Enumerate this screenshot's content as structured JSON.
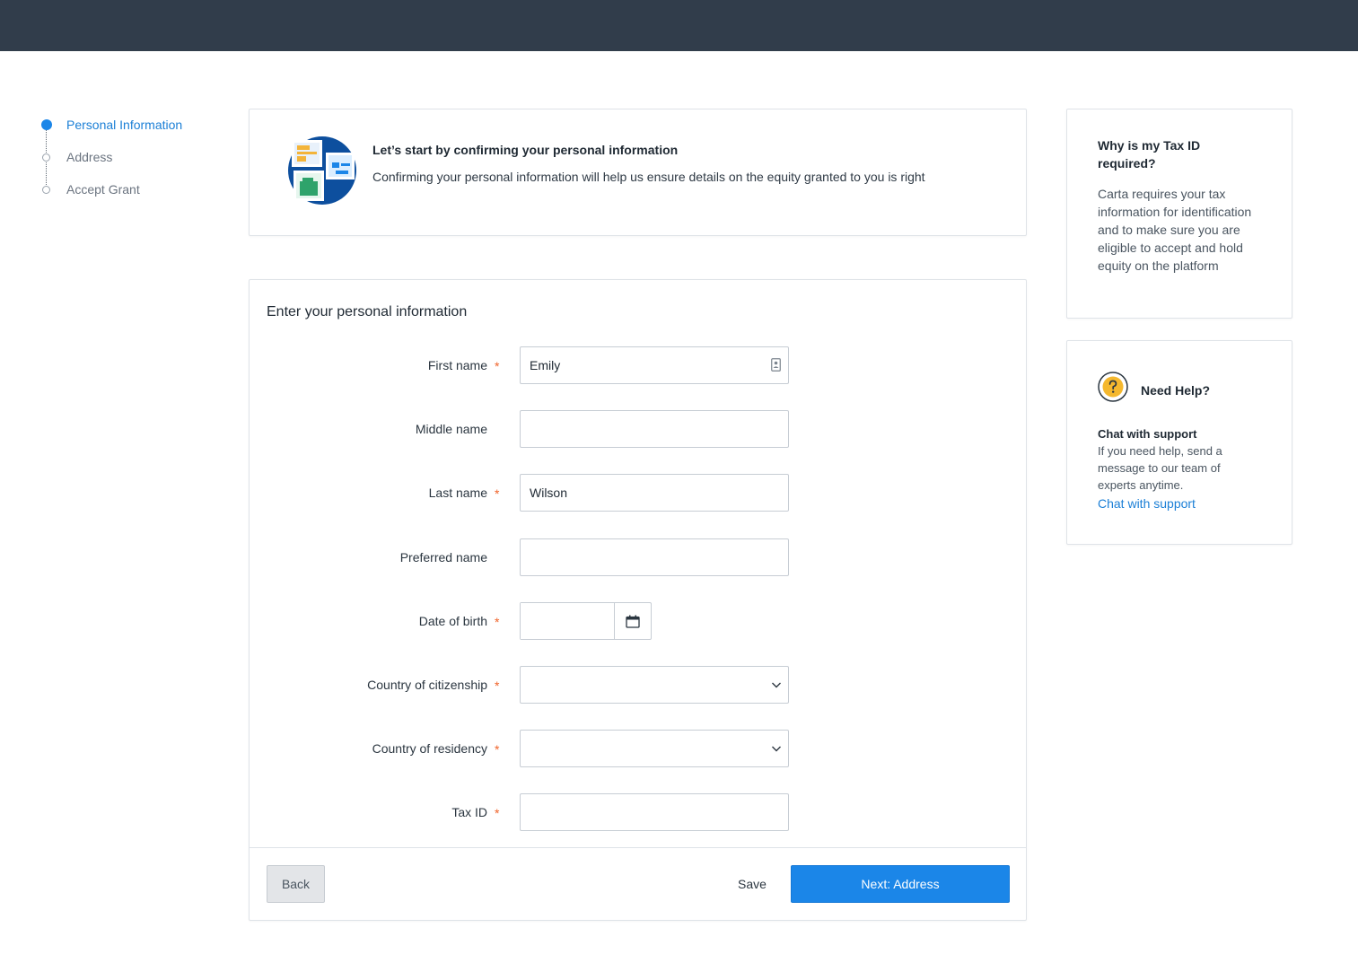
{
  "stepper": {
    "steps": [
      {
        "label": "Personal Information",
        "active": true
      },
      {
        "label": "Address",
        "active": false
      },
      {
        "label": "Accept Grant",
        "active": false
      }
    ]
  },
  "intro": {
    "title": "Let’s start by confirming your personal information",
    "text": "Confirming your personal information will help us ensure details on the equity granted to you is right"
  },
  "form": {
    "title": "Enter your personal information",
    "required_marker": "*",
    "fields": {
      "first_name": {
        "label": "First name",
        "value": "Emily",
        "required": true
      },
      "middle_name": {
        "label": "Middle name",
        "value": "",
        "required": false
      },
      "last_name": {
        "label": "Last name",
        "value": "Wilson",
        "required": true
      },
      "preferred_name": {
        "label": "Preferred name",
        "value": "",
        "required": false
      },
      "date_of_birth": {
        "label": "Date of birth",
        "value": "",
        "required": true
      },
      "country_citizenship": {
        "label": "Country of citizenship",
        "value": "",
        "required": true
      },
      "country_residency": {
        "label": "Country of residency",
        "value": "",
        "required": true
      },
      "tax_id": {
        "label": "Tax ID",
        "value": "",
        "required": true
      }
    },
    "buttons": {
      "back": "Back",
      "save": "Save",
      "next": "Next: Address"
    }
  },
  "taxid_info": {
    "title": "Why is my Tax ID required?",
    "body": "Carta requires your tax information for identification and to make sure you are eligible to accept and hold equity on the platform"
  },
  "help": {
    "title": "Need Help?",
    "chat_heading": "Chat with support",
    "chat_body": "If you need help, send a message to our team of experts anytime.",
    "chat_link": "Chat with support"
  },
  "colors": {
    "topbar": "#313d4b",
    "accent": "#1b86e8",
    "required": "#f0642a",
    "help_icon": "#f5b82e"
  },
  "icons": {
    "contact_card": "contact-card-icon",
    "calendar": "calendar-icon",
    "chevron": "chevron-down-icon",
    "help": "question-mark-icon"
  }
}
